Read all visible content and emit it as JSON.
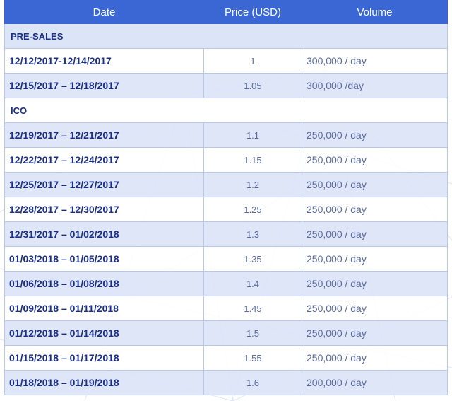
{
  "headers": {
    "date": "Date",
    "price": "Price (USD)",
    "volume": "Volume"
  },
  "sections": {
    "presales": "PRE-SALES",
    "ico": "ICO"
  },
  "presales_rows": [
    {
      "date": "12/12/2017-12/14/2017",
      "price": "1",
      "volume": "300,000 / day"
    },
    {
      "date": "12/15/2017 – 12/18/2017",
      "price": "1.05",
      "volume": "300,000 /day"
    }
  ],
  "ico_rows": [
    {
      "date": "12/19/2017 – 12/21/2017",
      "price": "1.1",
      "volume": "250,000 / day"
    },
    {
      "date": "12/22/2017 – 12/24/2017",
      "price": "1.15",
      "volume": "250,000 / day"
    },
    {
      "date": "12/25/2017 – 12/27/2017",
      "price": "1.2",
      "volume": "250,000 / day"
    },
    {
      "date": "12/28/2017 – 12/30/2017",
      "price": "1.25",
      "volume": "250,000 / day"
    },
    {
      "date": "12/31/2017 – 01/02/2018",
      "price": "1.3",
      "volume": "250,000 / day"
    },
    {
      "date": "01/03/2018 – 01/05/2018",
      "price": "1.35",
      "volume": "250,000 / day"
    },
    {
      "date": "01/06/2018 – 01/08/2018",
      "price": "1.4",
      "volume": "250,000 / day"
    },
    {
      "date": "01/09/2018 – 01/11/2018",
      "price": "1.45",
      "volume": "250,000 / day"
    },
    {
      "date": "01/12/2018 – 01/14/2018",
      "price": "1.5",
      "volume": "250,000 / day"
    },
    {
      "date": "01/15/2018 – 01/17/2018",
      "price": "1.55",
      "volume": "250,000 / day"
    },
    {
      "date": "01/18/2018 – 01/19/2018",
      "price": "1.6",
      "volume": "200,000 / day"
    }
  ],
  "colors": {
    "header_bg": "#3a67d3",
    "section_bg": "#dce4f7",
    "text_primary": "#1a2f8a",
    "text_muted": "#5a6aa0",
    "border": "#b9c7e8"
  }
}
